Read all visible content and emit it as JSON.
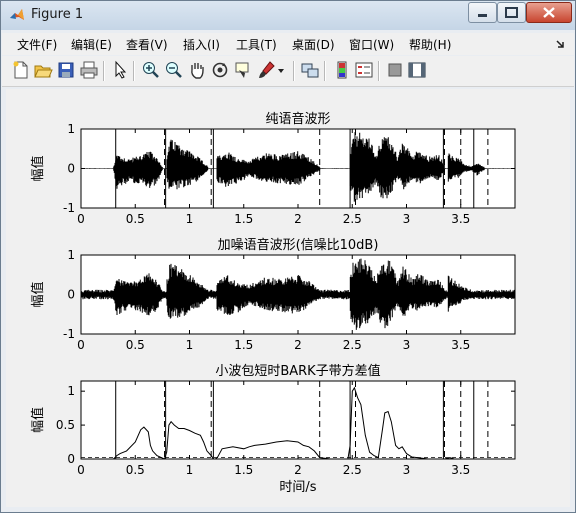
{
  "window": {
    "title": "Figure 1"
  },
  "menu": [
    "文件(F)",
    "编辑(E)",
    "查看(V)",
    "插入(I)",
    "工具(T)",
    "桌面(D)",
    "窗口(W)",
    "帮助(H)"
  ],
  "toolbar_icons": [
    "new-figure-icon",
    "open-file-icon",
    "save-icon",
    "print-icon",
    "edit-plot-arrow-icon",
    "zoom-in-icon",
    "zoom-out-icon",
    "pan-hand-icon",
    "rotate-3d-icon",
    "data-cursor-icon",
    "brush-icon",
    "brush-dropdown-icon",
    "link-plot-icon",
    "insert-colorbar-icon",
    "insert-legend-icon",
    "hide-plot-tools-icon",
    "show-plot-tools-icon"
  ],
  "chart_data": [
    {
      "type": "line",
      "title": "纯语音波形",
      "xlabel": "",
      "ylabel": "幅值",
      "xlim": [
        0,
        4.0
      ],
      "ylim": [
        -1,
        1
      ],
      "xticks": [
        "0",
        "0.5",
        "1",
        "1.5",
        "2",
        "2.5",
        "3",
        "3.5"
      ],
      "yticks": [
        "-1",
        "0",
        "1"
      ],
      "series": [
        {
          "style": "speech-waveform envelope",
          "segments": [
            {
              "x": [
                0.3,
                0.33,
                0.38,
                0.45,
                0.55,
                0.63,
                0.7,
                0.75
              ],
              "amp_top": [
                0.05,
                0.4,
                0.3,
                0.25,
                0.35,
                0.45,
                0.3,
                0.05
              ],
              "amp_bottom": [
                0.05,
                0.55,
                0.45,
                0.35,
                0.4,
                0.5,
                0.4,
                0.05
              ]
            },
            {
              "x": [
                0.79,
                0.82,
                0.87,
                0.95,
                1.03,
                1.1,
                1.17
              ],
              "amp_top": [
                0.3,
                0.75,
                0.7,
                0.55,
                0.4,
                0.25,
                0.05
              ],
              "amp_bottom": [
                0.4,
                0.6,
                0.55,
                0.5,
                0.4,
                0.25,
                0.05
              ]
            },
            {
              "x": [
                1.25,
                1.35,
                1.45,
                1.55,
                1.7,
                1.85,
                2.0,
                2.1,
                2.2
              ],
              "amp_top": [
                0.3,
                0.45,
                0.25,
                0.2,
                0.4,
                0.35,
                0.45,
                0.3,
                0.05
              ],
              "amp_bottom": [
                0.35,
                0.5,
                0.4,
                0.2,
                0.35,
                0.4,
                0.45,
                0.25,
                0.05
              ]
            },
            {
              "x": [
                2.48,
                2.52,
                2.58,
                2.65,
                2.72,
                2.78,
                2.85,
                2.92,
                2.97,
                3.05,
                3.12,
                3.2,
                3.3,
                3.35
              ],
              "amp_top": [
                0.4,
                0.95,
                0.9,
                0.8,
                0.4,
                0.85,
                0.8,
                0.3,
                0.7,
                0.35,
                0.5,
                0.3,
                0.35,
                0.1
              ],
              "amp_bottom": [
                0.5,
                0.9,
                0.8,
                0.7,
                0.4,
                0.85,
                0.7,
                0.25,
                0.55,
                0.3,
                0.4,
                0.25,
                0.3,
                0.1
              ]
            },
            {
              "x": [
                3.38,
                3.42,
                3.48,
                3.52,
                3.6
              ],
              "amp_top": [
                0.45,
                0.35,
                0.25,
                0.15,
                0.05
              ],
              "amp_bottom": [
                0.4,
                0.3,
                0.25,
                0.1,
                0.05
              ]
            },
            {
              "x": [
                3.6,
                3.65,
                3.72
              ],
              "amp_top": [
                0.05,
                0.15,
                0.03
              ],
              "amp_bottom": [
                0.05,
                0.18,
                0.03
              ]
            }
          ]
        }
      ],
      "solid_vlines": [
        0.32,
        0.78,
        1.22,
        2.48,
        3.34,
        3.62
      ],
      "dashed_vlines": [
        0.77,
        1.2,
        2.2,
        2.53,
        3.35,
        3.5,
        3.75
      ]
    },
    {
      "type": "line",
      "title": "加噪语音波形(信噪比10dB)",
      "xlabel": "",
      "ylabel": "幅值",
      "xlim": [
        0,
        4.0
      ],
      "ylim": [
        -1,
        1
      ],
      "xticks": [
        "0",
        "0.5",
        "1",
        "1.5",
        "2",
        "2.5",
        "3",
        "3.5"
      ],
      "yticks": [
        "-1",
        "0",
        "1"
      ],
      "noise_floor": 0.12,
      "series": [
        {
          "style": "speech-waveform envelope with noise",
          "segments": [
            {
              "x": [
                0.3,
                0.33,
                0.38,
                0.45,
                0.55,
                0.63,
                0.7,
                0.75
              ],
              "amp_top": [
                0.12,
                0.45,
                0.35,
                0.3,
                0.4,
                0.55,
                0.35,
                0.12
              ],
              "amp_bottom": [
                0.12,
                0.55,
                0.45,
                0.4,
                0.45,
                0.55,
                0.45,
                0.12
              ]
            },
            {
              "x": [
                0.79,
                0.82,
                0.87,
                0.95,
                1.03,
                1.1,
                1.17
              ],
              "amp_top": [
                0.35,
                0.8,
                0.75,
                0.6,
                0.45,
                0.3,
                0.12
              ],
              "amp_bottom": [
                0.45,
                0.65,
                0.6,
                0.55,
                0.45,
                0.3,
                0.12
              ]
            },
            {
              "x": [
                1.25,
                1.35,
                1.45,
                1.55,
                1.7,
                1.85,
                2.0,
                2.1,
                2.2
              ],
              "amp_top": [
                0.35,
                0.5,
                0.3,
                0.25,
                0.45,
                0.4,
                0.5,
                0.35,
                0.12
              ],
              "amp_bottom": [
                0.4,
                0.55,
                0.45,
                0.25,
                0.4,
                0.45,
                0.5,
                0.3,
                0.12
              ]
            },
            {
              "x": [
                2.48,
                2.52,
                2.58,
                2.65,
                2.72,
                2.78,
                2.85,
                2.92,
                2.97,
                3.05,
                3.12,
                3.2,
                3.3,
                3.35
              ],
              "amp_top": [
                0.45,
                1.0,
                0.95,
                0.85,
                0.45,
                0.9,
                0.85,
                0.35,
                0.75,
                0.4,
                0.55,
                0.35,
                0.4,
                0.15
              ],
              "amp_bottom": [
                0.55,
                0.95,
                0.85,
                0.75,
                0.45,
                0.9,
                0.75,
                0.3,
                0.6,
                0.35,
                0.45,
                0.3,
                0.35,
                0.15
              ]
            },
            {
              "x": [
                3.38,
                3.42,
                3.48,
                3.52,
                3.6
              ],
              "amp_top": [
                0.5,
                0.4,
                0.3,
                0.2,
                0.12
              ],
              "amp_bottom": [
                0.45,
                0.35,
                0.3,
                0.15,
                0.12
              ]
            }
          ]
        }
      ],
      "solid_vlines": [],
      "dashed_vlines": []
    },
    {
      "type": "line",
      "title": "小波包短时BARK子带方差值",
      "xlabel": "时间/s",
      "ylabel": "幅值",
      "xlim": [
        0,
        4.0
      ],
      "ylim": [
        0,
        1.15
      ],
      "xticks": [
        "0",
        "0.5",
        "1",
        "1.5",
        "2",
        "2.5",
        "3",
        "3.5"
      ],
      "yticks": [
        "0",
        "0.5",
        "1"
      ],
      "series": [
        {
          "name": "",
          "x": [
            0.0,
            0.25,
            0.3,
            0.33,
            0.36,
            0.42,
            0.5,
            0.55,
            0.58,
            0.62,
            0.64,
            0.66,
            0.7,
            0.74,
            0.77,
            0.79,
            0.81,
            0.83,
            0.86,
            0.9,
            0.95,
            1.0,
            1.05,
            1.1,
            1.13,
            1.16,
            1.2,
            1.22,
            1.24,
            1.26,
            1.3,
            1.4,
            1.5,
            1.55,
            1.6,
            1.7,
            1.8,
            1.9,
            2.0,
            2.05,
            2.1,
            2.15,
            2.2,
            2.3,
            2.4,
            2.46,
            2.48,
            2.5,
            2.52,
            2.55,
            2.58,
            2.62,
            2.66,
            2.7,
            2.74,
            2.78,
            2.8,
            2.83,
            2.86,
            2.9,
            2.93,
            2.96,
            3.0,
            3.05,
            3.1,
            3.2,
            3.3,
            3.35,
            3.4,
            3.44,
            3.5,
            3.55,
            3.6,
            3.65,
            3.7,
            3.8,
            4.0
          ],
          "y": [
            0.0,
            0.0,
            0.0,
            0.05,
            0.08,
            0.12,
            0.25,
            0.43,
            0.47,
            0.4,
            0.2,
            0.12,
            0.05,
            0.02,
            0.0,
            0.1,
            0.5,
            0.55,
            0.5,
            0.45,
            0.45,
            0.42,
            0.38,
            0.35,
            0.25,
            0.12,
            0.05,
            0.0,
            0.0,
            0.03,
            0.15,
            0.18,
            0.15,
            0.18,
            0.2,
            0.22,
            0.25,
            0.27,
            0.25,
            0.2,
            0.18,
            0.12,
            0.02,
            0.0,
            0.0,
            0.0,
            0.2,
            1.0,
            1.05,
            0.9,
            0.8,
            0.35,
            0.1,
            0.05,
            0.02,
            0.45,
            0.68,
            0.7,
            0.55,
            0.2,
            0.15,
            0.18,
            0.08,
            0.03,
            0.02,
            0.0,
            0.0,
            0.0,
            0.02,
            0.0,
            0.0,
            0.0,
            0.0,
            0.0,
            0.0,
            0.0,
            0.0
          ]
        }
      ],
      "solid_vlines": [
        0.32,
        0.78,
        1.22,
        2.48,
        3.34,
        3.62
      ],
      "dashed_vlines": [
        0.77,
        1.2,
        2.2,
        2.53,
        3.35,
        3.5,
        3.75
      ]
    }
  ]
}
